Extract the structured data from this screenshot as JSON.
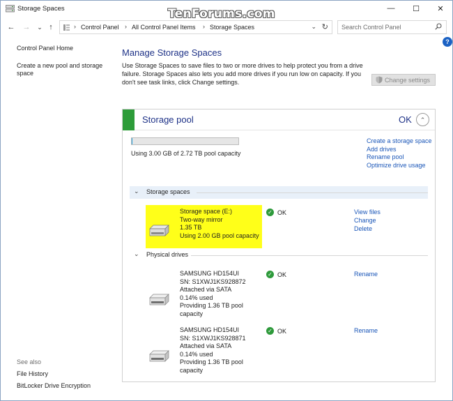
{
  "window": {
    "title": "Storage Spaces",
    "watermark": "TenForums.com",
    "minimize_glyph": "—",
    "maximize_glyph": "☐",
    "close_glyph": "✕"
  },
  "nav": {
    "back_glyph": "←",
    "forward_glyph": "→",
    "recent_glyph": "⌄",
    "up_glyph": "↑"
  },
  "address": {
    "crumbs": [
      "Control Panel",
      "All Control Panel Items",
      "Storage Spaces"
    ],
    "separator": "›",
    "dropdown_glyph": "⌄",
    "refresh_glyph": "↻"
  },
  "search": {
    "placeholder": "Search Control Panel"
  },
  "help_glyph": "?",
  "sidebar": {
    "items": [
      {
        "label": "Control Panel Home"
      },
      {
        "label": "Create a new pool and storage space"
      }
    ],
    "see_also_label": "See also",
    "see_also": [
      {
        "label": "File History"
      },
      {
        "label": "BitLocker Drive Encryption"
      }
    ]
  },
  "main": {
    "title": "Manage Storage Spaces",
    "description": "Use Storage Spaces to save files to two or more drives to help protect you from a drive failure. Storage Spaces also lets you add more drives if you run low on capacity. If you don't see task links, click Change settings.",
    "change_settings_label": "Change settings"
  },
  "pool": {
    "title": "Storage pool",
    "status": "OK",
    "collapse_glyph": "⌃",
    "usage_text": "Using 3.00 GB of 2.72 TB pool capacity",
    "usage_fraction": 0.001,
    "links": [
      {
        "label": "Create a storage space"
      },
      {
        "label": "Add drives"
      },
      {
        "label": "Rename pool"
      },
      {
        "label": "Optimize drive usage"
      }
    ],
    "storage_spaces_label": "Storage spaces",
    "physical_drives_label": "Physical drives",
    "section_chevron": "⌄",
    "ok_check": "✓",
    "storage_space": {
      "name": "Storage space (E:)",
      "resiliency": "Two-way mirror",
      "size": "1.35 TB",
      "usage": "Using 2.00 GB pool capacity",
      "status": "OK",
      "links": [
        {
          "label": "View files"
        },
        {
          "label": "Change"
        },
        {
          "label": "Delete"
        }
      ]
    },
    "drives": [
      {
        "name": "SAMSUNG HD154UI",
        "serial": "SN: S1XWJ1KS928872",
        "connection": "Attached via SATA",
        "used": "0.14% used",
        "providing_1": "Providing 1.36 TB pool",
        "providing_2": "capacity",
        "status": "OK",
        "link": "Rename"
      },
      {
        "name": "SAMSUNG HD154UI",
        "serial": "SN: S1XWJ1KS928871",
        "connection": "Attached via SATA",
        "used": "0.14% used",
        "providing_1": "Providing 1.36 TB pool",
        "providing_2": "capacity",
        "status": "OK",
        "link": "Rename"
      }
    ]
  }
}
